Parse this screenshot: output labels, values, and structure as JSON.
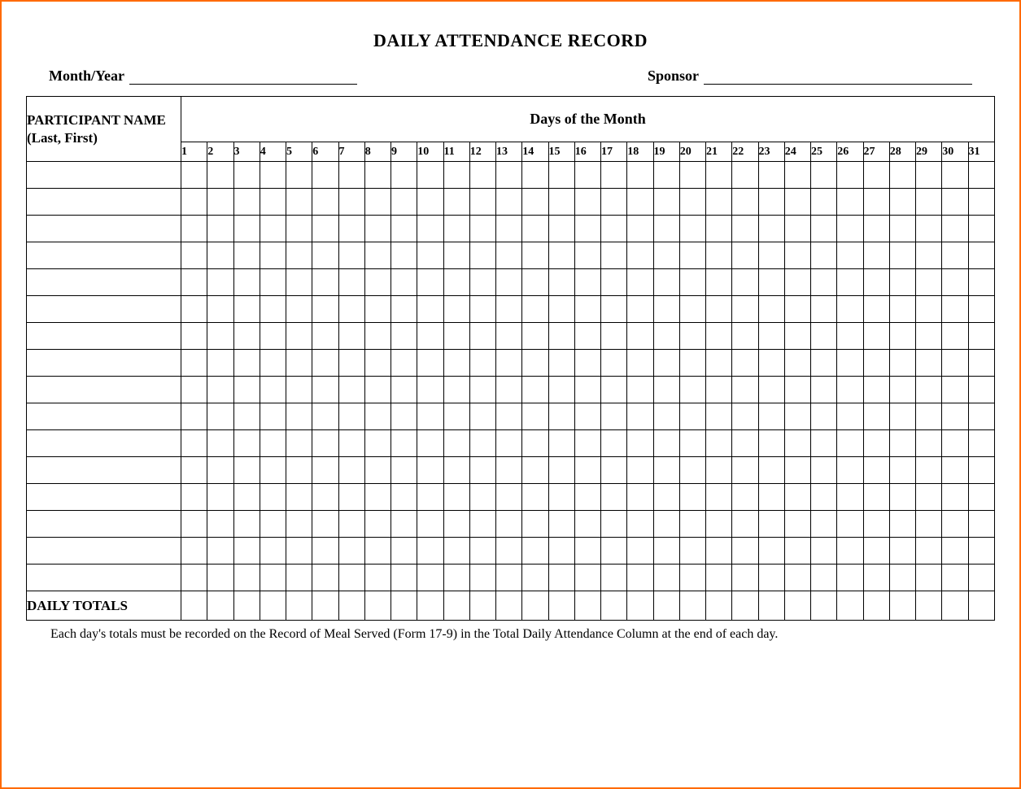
{
  "title": "DAILY ATTENDANCE RECORD",
  "meta": {
    "month_year_label": "Month/Year",
    "sponsor_label": "Sponsor"
  },
  "headers": {
    "participant": "PARTICIPANT NAME (Last, First)",
    "days_of_month": "Days of the Month",
    "totals": "DAILY TOTALS"
  },
  "days": [
    "1",
    "2",
    "3",
    "4",
    "5",
    "6",
    "7",
    "8",
    "9",
    "10",
    "11",
    "12",
    "13",
    "14",
    "15",
    "16",
    "17",
    "18",
    "19",
    "20",
    "21",
    "22",
    "23",
    "24",
    "25",
    "26",
    "27",
    "28",
    "29",
    "30",
    "31"
  ],
  "participant_rows": 16,
  "footnote": "Each day's totals must be recorded on the Record of Meal Served (Form 17-9) in the Total Daily Attendance Column at the end of each day."
}
